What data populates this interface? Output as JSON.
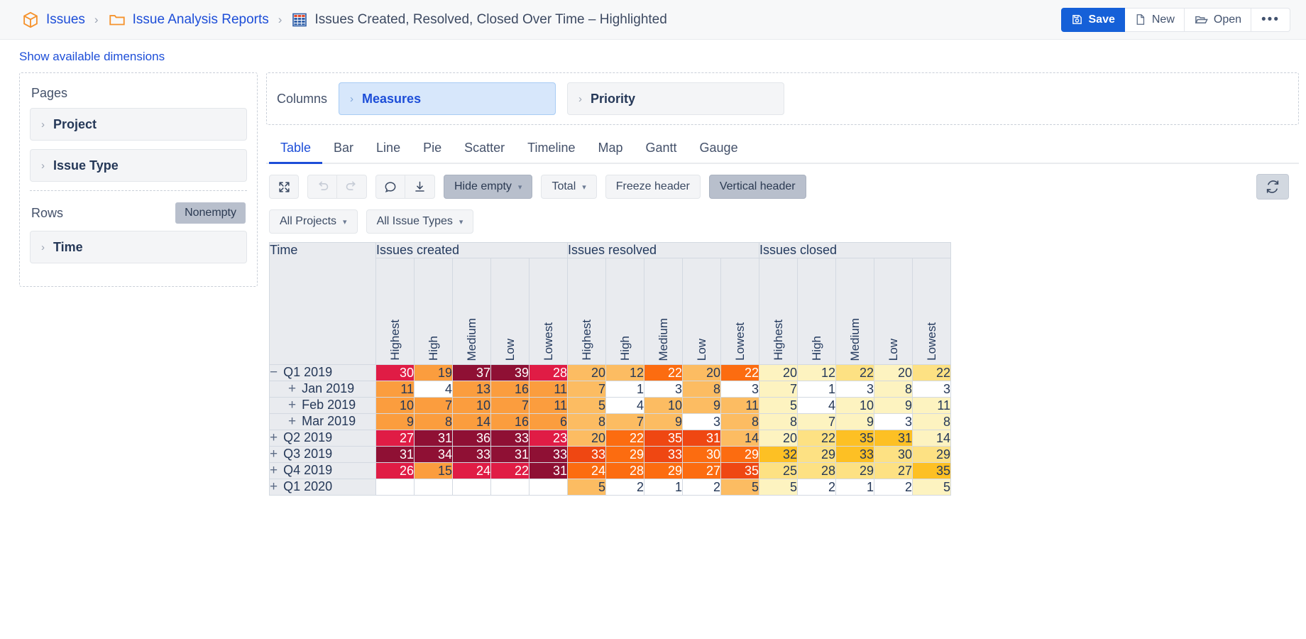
{
  "breadcrumb": {
    "items": [
      {
        "label": "Issues",
        "icon": "cube-icon",
        "type": "link"
      },
      {
        "label": "Issue Analysis Reports",
        "icon": "folder-icon",
        "type": "link"
      },
      {
        "label": "Issues Created, Resolved, Closed Over Time – Highlighted",
        "icon": "table-icon",
        "type": "title"
      }
    ],
    "separator": "›"
  },
  "top_actions": {
    "save": "Save",
    "new": "New",
    "open": "Open",
    "more": "•••"
  },
  "show_dimensions": "Show available dimensions",
  "pages": {
    "label": "Pages",
    "items": [
      {
        "label": "Project"
      },
      {
        "label": "Issue Type"
      }
    ]
  },
  "rows": {
    "label": "Rows",
    "nonempty": "Nonempty",
    "items": [
      {
        "label": "Time"
      }
    ]
  },
  "columns": {
    "label": "Columns",
    "items": [
      {
        "label": "Measures",
        "active": true
      },
      {
        "label": "Priority",
        "active": false
      }
    ]
  },
  "tabs": [
    {
      "label": "Table",
      "selected": true
    },
    {
      "label": "Bar",
      "selected": false
    },
    {
      "label": "Line",
      "selected": false
    },
    {
      "label": "Pie",
      "selected": false
    },
    {
      "label": "Scatter",
      "selected": false
    },
    {
      "label": "Timeline",
      "selected": false
    },
    {
      "label": "Map",
      "selected": false
    },
    {
      "label": "Gantt",
      "selected": false
    },
    {
      "label": "Gauge",
      "selected": false
    }
  ],
  "toolbar": {
    "expand_icon": "expand-arrows-icon",
    "undo_icon": "undo-icon",
    "redo_icon": "redo-icon",
    "comment_icon": "comment-icon",
    "download_icon": "download-icon",
    "hide_empty": "Hide empty",
    "total": "Total",
    "freeze_header": "Freeze header",
    "vertical_header": "Vertical header",
    "refresh_icon": "refresh-icon",
    "caret": "⌄"
  },
  "filters": [
    {
      "label": "All Projects"
    },
    {
      "label": "All Issue Types"
    }
  ],
  "chart_data": {
    "type": "table",
    "title": "Issues Created, Resolved, Closed Over Time – Highlighted",
    "row_header": "Time",
    "measures": [
      "Issues created",
      "Issues resolved",
      "Issues closed"
    ],
    "priorities": [
      "Highest",
      "High",
      "Medium",
      "Low",
      "Lowest"
    ],
    "rows": [
      {
        "label": "Q1 2019",
        "expander": "−",
        "indent": 0,
        "cells": [
          {
            "v": "30",
            "bg": "#e01c45",
            "fg": "#ffffff"
          },
          {
            "v": "19",
            "bg": "#fb9d3e",
            "fg": "#253858"
          },
          {
            "v": "37",
            "bg": "#8f1034",
            "fg": "#ffffff"
          },
          {
            "v": "39",
            "bg": "#8f1034",
            "fg": "#ffffff"
          },
          {
            "v": "28",
            "bg": "#e01c45",
            "fg": "#ffffff"
          },
          {
            "v": "20",
            "bg": "#fcbc62",
            "fg": "#253858"
          },
          {
            "v": "12",
            "bg": "#fcbc62",
            "fg": "#253858"
          },
          {
            "v": "22",
            "bg": "#fc6c10",
            "fg": "#ffffff"
          },
          {
            "v": "20",
            "bg": "#fcbc62",
            "fg": "#253858"
          },
          {
            "v": "22",
            "bg": "#fc6c10",
            "fg": "#ffffff"
          },
          {
            "v": "20",
            "bg": "#fdf3c0",
            "fg": "#253858"
          },
          {
            "v": "12",
            "bg": "#fdf3c0",
            "fg": "#253858"
          },
          {
            "v": "22",
            "bg": "#fde183",
            "fg": "#253858"
          },
          {
            "v": "20",
            "bg": "#fdf3c0",
            "fg": "#253858"
          },
          {
            "v": "22",
            "bg": "#fde183",
            "fg": "#253858"
          }
        ]
      },
      {
        "label": "Jan 2019",
        "expander": "+",
        "indent": 1,
        "cells": [
          {
            "v": "11",
            "bg": "#fb9d3e",
            "fg": "#253858"
          },
          {
            "v": "4",
            "bg": "#ffffff",
            "fg": "#253858"
          },
          {
            "v": "13",
            "bg": "#fb9d3e",
            "fg": "#253858"
          },
          {
            "v": "16",
            "bg": "#fb9d3e",
            "fg": "#253858"
          },
          {
            "v": "11",
            "bg": "#fb9d3e",
            "fg": "#253858"
          },
          {
            "v": "7",
            "bg": "#fcbc62",
            "fg": "#253858"
          },
          {
            "v": "1",
            "bg": "#ffffff",
            "fg": "#253858"
          },
          {
            "v": "3",
            "bg": "#ffffff",
            "fg": "#253858"
          },
          {
            "v": "8",
            "bg": "#fcbc62",
            "fg": "#253858"
          },
          {
            "v": "3",
            "bg": "#ffffff",
            "fg": "#253858"
          },
          {
            "v": "7",
            "bg": "#fdf3c0",
            "fg": "#253858"
          },
          {
            "v": "1",
            "bg": "#ffffff",
            "fg": "#253858"
          },
          {
            "v": "3",
            "bg": "#ffffff",
            "fg": "#253858"
          },
          {
            "v": "8",
            "bg": "#fdf3c0",
            "fg": "#253858"
          },
          {
            "v": "3",
            "bg": "#ffffff",
            "fg": "#253858"
          }
        ]
      },
      {
        "label": "Feb 2019",
        "expander": "+",
        "indent": 1,
        "cells": [
          {
            "v": "10",
            "bg": "#fb9d3e",
            "fg": "#253858"
          },
          {
            "v": "7",
            "bg": "#fb9d3e",
            "fg": "#253858"
          },
          {
            "v": "10",
            "bg": "#fb9d3e",
            "fg": "#253858"
          },
          {
            "v": "7",
            "bg": "#fb9d3e",
            "fg": "#253858"
          },
          {
            "v": "11",
            "bg": "#fb9d3e",
            "fg": "#253858"
          },
          {
            "v": "5",
            "bg": "#fcbc62",
            "fg": "#253858"
          },
          {
            "v": "4",
            "bg": "#ffffff",
            "fg": "#253858"
          },
          {
            "v": "10",
            "bg": "#fcbc62",
            "fg": "#253858"
          },
          {
            "v": "9",
            "bg": "#fcbc62",
            "fg": "#253858"
          },
          {
            "v": "11",
            "bg": "#fcbc62",
            "fg": "#253858"
          },
          {
            "v": "5",
            "bg": "#fdf3c0",
            "fg": "#253858"
          },
          {
            "v": "4",
            "bg": "#ffffff",
            "fg": "#253858"
          },
          {
            "v": "10",
            "bg": "#fdf3c0",
            "fg": "#253858"
          },
          {
            "v": "9",
            "bg": "#fdf3c0",
            "fg": "#253858"
          },
          {
            "v": "11",
            "bg": "#fdf3c0",
            "fg": "#253858"
          }
        ]
      },
      {
        "label": "Mar 2019",
        "expander": "+",
        "indent": 1,
        "cells": [
          {
            "v": "9",
            "bg": "#fb9d3e",
            "fg": "#253858"
          },
          {
            "v": "8",
            "bg": "#fb9d3e",
            "fg": "#253858"
          },
          {
            "v": "14",
            "bg": "#fb9d3e",
            "fg": "#253858"
          },
          {
            "v": "16",
            "bg": "#fb9d3e",
            "fg": "#253858"
          },
          {
            "v": "6",
            "bg": "#fb9d3e",
            "fg": "#253858"
          },
          {
            "v": "8",
            "bg": "#fcbc62",
            "fg": "#253858"
          },
          {
            "v": "7",
            "bg": "#fcbc62",
            "fg": "#253858"
          },
          {
            "v": "9",
            "bg": "#fcbc62",
            "fg": "#253858"
          },
          {
            "v": "3",
            "bg": "#ffffff",
            "fg": "#253858"
          },
          {
            "v": "8",
            "bg": "#fcbc62",
            "fg": "#253858"
          },
          {
            "v": "8",
            "bg": "#fdf3c0",
            "fg": "#253858"
          },
          {
            "v": "7",
            "bg": "#fdf3c0",
            "fg": "#253858"
          },
          {
            "v": "9",
            "bg": "#fdf3c0",
            "fg": "#253858"
          },
          {
            "v": "3",
            "bg": "#ffffff",
            "fg": "#253858"
          },
          {
            "v": "8",
            "bg": "#fdf3c0",
            "fg": "#253858"
          }
        ]
      },
      {
        "label": "Q2 2019",
        "expander": "+",
        "indent": 0,
        "cells": [
          {
            "v": "27",
            "bg": "#e01c45",
            "fg": "#ffffff"
          },
          {
            "v": "31",
            "bg": "#8f1034",
            "fg": "#ffffff"
          },
          {
            "v": "36",
            "bg": "#8f1034",
            "fg": "#ffffff"
          },
          {
            "v": "33",
            "bg": "#8f1034",
            "fg": "#ffffff"
          },
          {
            "v": "23",
            "bg": "#e01c45",
            "fg": "#ffffff"
          },
          {
            "v": "20",
            "bg": "#fcbc62",
            "fg": "#253858"
          },
          {
            "v": "22",
            "bg": "#fc6c10",
            "fg": "#ffffff"
          },
          {
            "v": "35",
            "bg": "#ef4712",
            "fg": "#ffffff"
          },
          {
            "v": "31",
            "bg": "#ef4712",
            "fg": "#ffffff"
          },
          {
            "v": "14",
            "bg": "#fcbc62",
            "fg": "#253858"
          },
          {
            "v": "20",
            "bg": "#fdf3c0",
            "fg": "#253858"
          },
          {
            "v": "22",
            "bg": "#fde183",
            "fg": "#253858"
          },
          {
            "v": "35",
            "bg": "#fdc024",
            "fg": "#253858"
          },
          {
            "v": "31",
            "bg": "#fdc024",
            "fg": "#253858"
          },
          {
            "v": "14",
            "bg": "#fdf3c0",
            "fg": "#253858"
          }
        ]
      },
      {
        "label": "Q3 2019",
        "expander": "+",
        "indent": 0,
        "cells": [
          {
            "v": "31",
            "bg": "#8f1034",
            "fg": "#ffffff"
          },
          {
            "v": "34",
            "bg": "#8f1034",
            "fg": "#ffffff"
          },
          {
            "v": "33",
            "bg": "#8f1034",
            "fg": "#ffffff"
          },
          {
            "v": "31",
            "bg": "#8f1034",
            "fg": "#ffffff"
          },
          {
            "v": "33",
            "bg": "#8f1034",
            "fg": "#ffffff"
          },
          {
            "v": "33",
            "bg": "#ef4712",
            "fg": "#ffffff"
          },
          {
            "v": "29",
            "bg": "#fc6c10",
            "fg": "#ffffff"
          },
          {
            "v": "33",
            "bg": "#ef4712",
            "fg": "#ffffff"
          },
          {
            "v": "30",
            "bg": "#fc6c10",
            "fg": "#ffffff"
          },
          {
            "v": "29",
            "bg": "#fc6c10",
            "fg": "#ffffff"
          },
          {
            "v": "32",
            "bg": "#fdc024",
            "fg": "#253858"
          },
          {
            "v": "29",
            "bg": "#fde183",
            "fg": "#253858"
          },
          {
            "v": "33",
            "bg": "#fdc024",
            "fg": "#253858"
          },
          {
            "v": "30",
            "bg": "#fde183",
            "fg": "#253858"
          },
          {
            "v": "29",
            "bg": "#fde183",
            "fg": "#253858"
          }
        ]
      },
      {
        "label": "Q4 2019",
        "expander": "+",
        "indent": 0,
        "cells": [
          {
            "v": "26",
            "bg": "#e01c45",
            "fg": "#ffffff"
          },
          {
            "v": "15",
            "bg": "#fb9d3e",
            "fg": "#253858"
          },
          {
            "v": "24",
            "bg": "#e01c45",
            "fg": "#ffffff"
          },
          {
            "v": "22",
            "bg": "#e01c45",
            "fg": "#ffffff"
          },
          {
            "v": "31",
            "bg": "#8f1034",
            "fg": "#ffffff"
          },
          {
            "v": "24",
            "bg": "#fc6c10",
            "fg": "#ffffff"
          },
          {
            "v": "28",
            "bg": "#fc6c10",
            "fg": "#ffffff"
          },
          {
            "v": "29",
            "bg": "#fc6c10",
            "fg": "#ffffff"
          },
          {
            "v": "27",
            "bg": "#fc6c10",
            "fg": "#ffffff"
          },
          {
            "v": "35",
            "bg": "#ef4712",
            "fg": "#ffffff"
          },
          {
            "v": "25",
            "bg": "#fde183",
            "fg": "#253858"
          },
          {
            "v": "28",
            "bg": "#fde183",
            "fg": "#253858"
          },
          {
            "v": "29",
            "bg": "#fde183",
            "fg": "#253858"
          },
          {
            "v": "27",
            "bg": "#fde183",
            "fg": "#253858"
          },
          {
            "v": "35",
            "bg": "#fdc024",
            "fg": "#253858"
          }
        ]
      },
      {
        "label": "Q1 2020",
        "expander": "+",
        "indent": 0,
        "cells": [
          {
            "v": "",
            "bg": "#ffffff",
            "fg": "#253858"
          },
          {
            "v": "",
            "bg": "#ffffff",
            "fg": "#253858"
          },
          {
            "v": "",
            "bg": "#ffffff",
            "fg": "#253858"
          },
          {
            "v": "",
            "bg": "#ffffff",
            "fg": "#253858"
          },
          {
            "v": "",
            "bg": "#ffffff",
            "fg": "#253858"
          },
          {
            "v": "5",
            "bg": "#fcbc62",
            "fg": "#253858"
          },
          {
            "v": "2",
            "bg": "#ffffff",
            "fg": "#253858"
          },
          {
            "v": "1",
            "bg": "#ffffff",
            "fg": "#253858"
          },
          {
            "v": "2",
            "bg": "#ffffff",
            "fg": "#253858"
          },
          {
            "v": "5",
            "bg": "#fcbc62",
            "fg": "#253858"
          },
          {
            "v": "5",
            "bg": "#fdf3c0",
            "fg": "#253858"
          },
          {
            "v": "2",
            "bg": "#ffffff",
            "fg": "#253858"
          },
          {
            "v": "1",
            "bg": "#ffffff",
            "fg": "#253858"
          },
          {
            "v": "2",
            "bg": "#ffffff",
            "fg": "#253858"
          },
          {
            "v": "5",
            "bg": "#fdf3c0",
            "fg": "#253858"
          }
        ]
      }
    ]
  }
}
